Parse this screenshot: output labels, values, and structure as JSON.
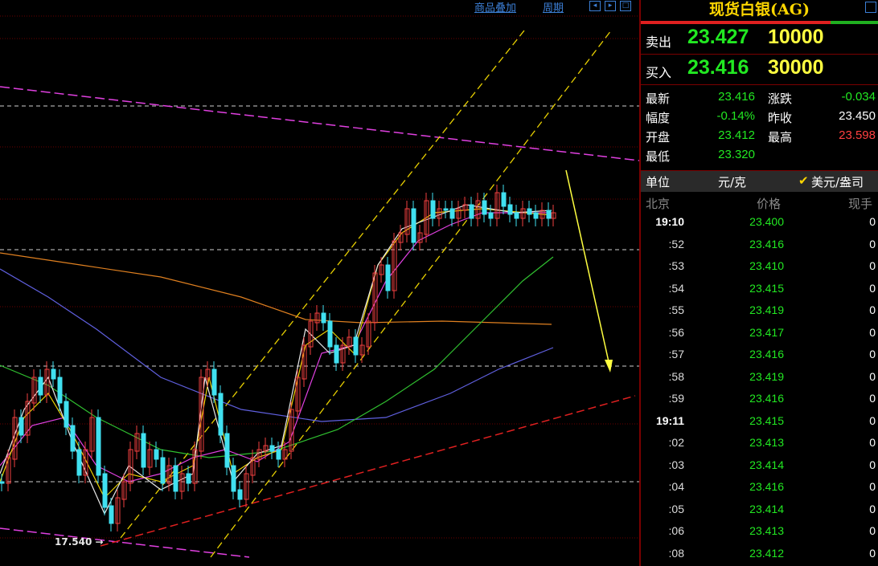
{
  "toolbar": {
    "overlay_link": "商品叠加",
    "period_link": "周期"
  },
  "chart": {
    "low_label": "17.540",
    "low_value": 17.54,
    "colors": {
      "up_candle": "#f04040",
      "down_candle": "#40e0f0",
      "ma_white": "#e8e8e8",
      "ma_yellow": "#e8d000",
      "ma_magenta": "#e040e0",
      "ma_green": "#30c030",
      "ma_blue": "#6060e0",
      "ma_orange": "#e08020",
      "channel": "#e8d000",
      "trend_red": "#e02020",
      "trend_magenta": "#e040e0",
      "arrow": "#ffff40"
    }
  },
  "panel": {
    "title": "现货白银(AG)",
    "sell": {
      "label": "卖出",
      "price": "23.427",
      "volume": "10000"
    },
    "buy": {
      "label": "买入",
      "price": "23.416",
      "volume": "30000"
    },
    "stats": [
      {
        "label": "最新",
        "value": "23.416",
        "color": "#22e822"
      },
      {
        "label": "涨跌",
        "value": "-0.034",
        "color": "#22e822"
      },
      {
        "label": "幅度",
        "value": "-0.14%",
        "color": "#22e822"
      },
      {
        "label": "昨收",
        "value": "23.450",
        "color": "#ffffff"
      },
      {
        "label": "开盘",
        "value": "23.412",
        "color": "#22e822"
      },
      {
        "label": "最高",
        "value": "23.598",
        "color": "#ff4040"
      },
      {
        "label": "最低",
        "value": "23.320",
        "color": "#22e822"
      }
    ],
    "unit_label": "单位",
    "unit_value": "元/克",
    "currency_option": "美元/盎司",
    "columns": {
      "location": "北京",
      "price": "价格",
      "volume": "现手"
    },
    "ticks": [
      {
        "time": "19:10",
        "price": "23.400",
        "vol": "0"
      },
      {
        "time": ":52",
        "price": "23.416",
        "vol": "0"
      },
      {
        "time": ":53",
        "price": "23.410",
        "vol": "0"
      },
      {
        "time": ":54",
        "price": "23.415",
        "vol": "0"
      },
      {
        "time": ":55",
        "price": "23.419",
        "vol": "0"
      },
      {
        "time": ":56",
        "price": "23.417",
        "vol": "0"
      },
      {
        "time": ":57",
        "price": "23.416",
        "vol": "0"
      },
      {
        "time": ":58",
        "price": "23.419",
        "vol": "0"
      },
      {
        "time": ":59",
        "price": "23.416",
        "vol": "0"
      },
      {
        "time": "19:11",
        "price": "23.415",
        "vol": "0"
      },
      {
        "time": ":02",
        "price": "23.413",
        "vol": "0"
      },
      {
        "time": ":03",
        "price": "23.414",
        "vol": "0"
      },
      {
        "time": ":04",
        "price": "23.416",
        "vol": "0"
      },
      {
        "time": ":05",
        "price": "23.414",
        "vol": "0"
      },
      {
        "time": ":06",
        "price": "23.413",
        "vol": "0"
      },
      {
        "time": ":08",
        "price": "23.412",
        "vol": "0"
      }
    ]
  }
}
